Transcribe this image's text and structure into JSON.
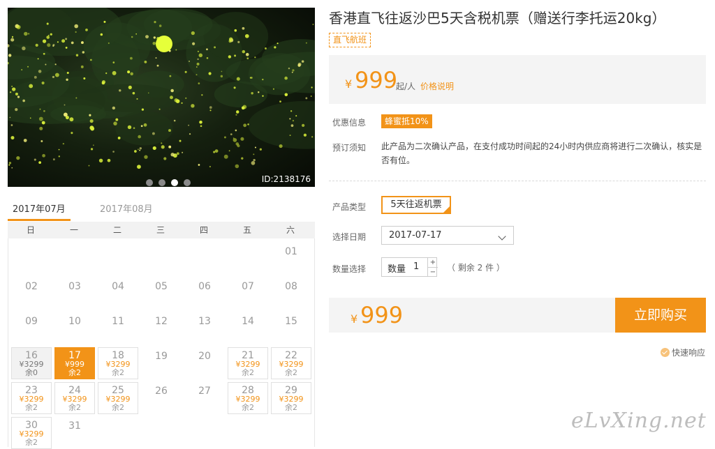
{
  "photo": {
    "id_label": "ID:2138176",
    "slides": 4,
    "active_slide": 3
  },
  "calendar": {
    "tabs": [
      "2017年07月",
      "2017年08月"
    ],
    "active_tab": 0,
    "weekdays": [
      "日",
      "一",
      "二",
      "三",
      "四",
      "五",
      "六"
    ],
    "days": [
      {
        "d": "01"
      },
      {
        "d": "02"
      },
      {
        "d": "03"
      },
      {
        "d": "04"
      },
      {
        "d": "05"
      },
      {
        "d": "06"
      },
      {
        "d": "07"
      },
      {
        "d": "08"
      },
      {
        "d": "09"
      },
      {
        "d": "10"
      },
      {
        "d": "11"
      },
      {
        "d": "12"
      },
      {
        "d": "13"
      },
      {
        "d": "14"
      },
      {
        "d": "15"
      },
      {
        "d": "16",
        "price": "¥3299",
        "remain": "余0",
        "state": "sold"
      },
      {
        "d": "17",
        "price": "¥999",
        "remain": "余2",
        "state": "selected"
      },
      {
        "d": "18",
        "price": "¥3299",
        "remain": "余2",
        "state": "avail"
      },
      {
        "d": "19"
      },
      {
        "d": "20"
      },
      {
        "d": "21",
        "price": "¥3299",
        "remain": "余2",
        "state": "avail"
      },
      {
        "d": "22",
        "price": "¥3299",
        "remain": "余2",
        "state": "avail"
      },
      {
        "d": "23",
        "price": "¥3299",
        "remain": "余2",
        "state": "avail"
      },
      {
        "d": "24",
        "price": "¥3299",
        "remain": "余2",
        "state": "avail"
      },
      {
        "d": "25",
        "price": "¥3299",
        "remain": "余2",
        "state": "avail"
      },
      {
        "d": "26"
      },
      {
        "d": "27"
      },
      {
        "d": "28",
        "price": "¥3299",
        "remain": "余2",
        "state": "avail"
      },
      {
        "d": "29",
        "price": "¥3299",
        "remain": "余2",
        "state": "avail"
      },
      {
        "d": "30",
        "price": "¥3299",
        "remain": "余2",
        "state": "avail"
      },
      {
        "d": "31"
      }
    ]
  },
  "product": {
    "title": "香港直飞往返沙巴5天含税机票（赠送行李托运20kg）",
    "tag": "直飞航班",
    "currency": "¥",
    "price": "999",
    "per": "起/人",
    "price_note": "价格说明",
    "promo_label": "优惠信息",
    "promo": "蜂蜜抵10%",
    "booking_label": "预订须知",
    "booking_text": "此产品为二次确认产品，在支付成功时间起的24小时内供应商将进行二次确认，核实是否有位。",
    "type_label": "产品类型",
    "type_value": "5天往返机票",
    "date_label": "选择日期",
    "date_value": "2017-07-17",
    "qty_label": "数量选择",
    "qty_field_label": "数量",
    "qty_value": "1",
    "plus": "+",
    "minus": "−",
    "remain": "（ 剩余 2 件 ）",
    "total_currency": "¥",
    "total": "999",
    "buy": "立即购买",
    "fast_response": "快速响应"
  },
  "watermark": "eLvXing.net",
  "colors": {
    "accent": "#f29318",
    "panel_bg": "#f4f4f4"
  }
}
